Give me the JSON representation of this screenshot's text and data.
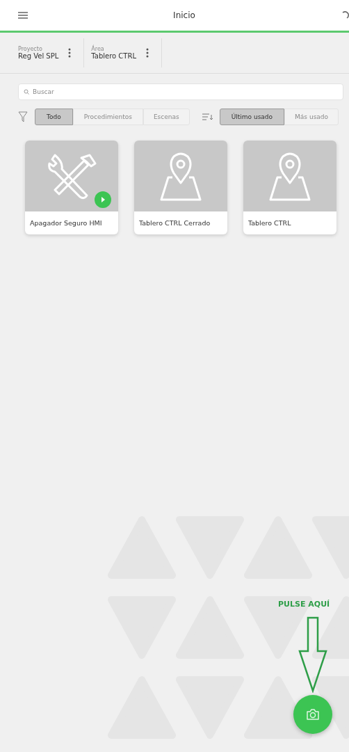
{
  "header": {
    "title": "Inicio"
  },
  "context": [
    {
      "label": "Proyecto",
      "value": "Reg Vel SPL"
    },
    {
      "label": "Área",
      "value": "Tablero CTRL"
    }
  ],
  "search": {
    "placeholder": "Buscar"
  },
  "filters": [
    {
      "label": "Todo",
      "selected": true
    },
    {
      "label": "Procedimientos",
      "selected": false
    },
    {
      "label": "Escenas",
      "selected": false
    }
  ],
  "sort": [
    {
      "label": "Último usado",
      "selected": true
    },
    {
      "label": "Más usado",
      "selected": false
    }
  ],
  "cards": [
    {
      "kind": "procedure",
      "title": "Apagador Seguro HMI",
      "playable": true
    },
    {
      "kind": "scene",
      "title": "Tablero CTRL Cerrado",
      "playable": false
    },
    {
      "kind": "scene",
      "title": "Tablero CTRL",
      "playable": false
    }
  ],
  "hint": {
    "text": "PULSE AQUÍ"
  }
}
